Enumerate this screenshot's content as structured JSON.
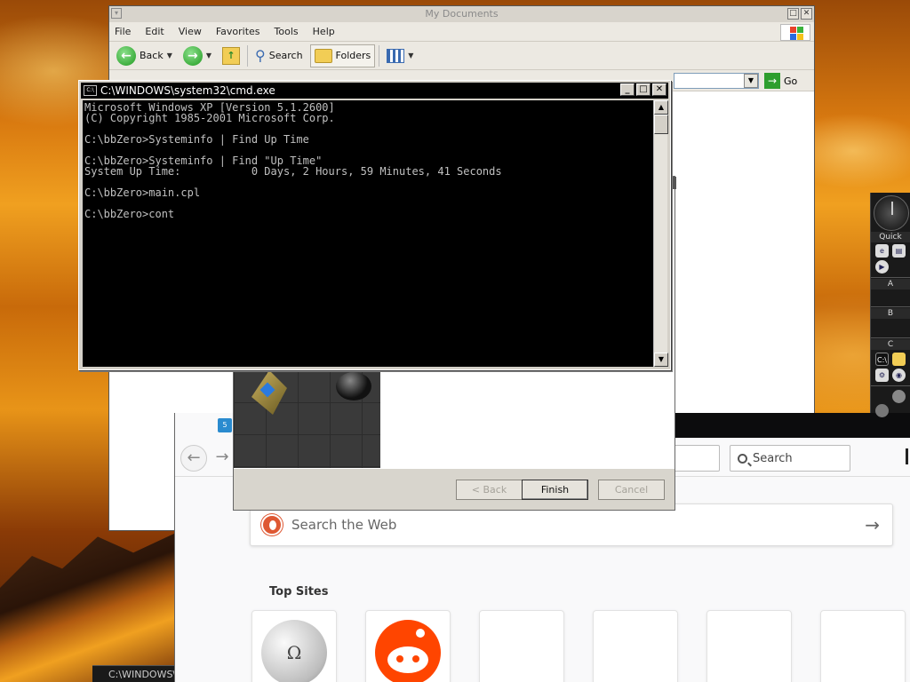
{
  "explorer": {
    "title": "My Documents",
    "menu": [
      "File",
      "Edit",
      "View",
      "Favorites",
      "Tools",
      "Help"
    ],
    "toolbar": {
      "back": "Back",
      "search": "Search",
      "folders": "Folders"
    },
    "address_go": "Go"
  },
  "cmd": {
    "title": "C:\\WINDOWS\\system32\\cmd.exe",
    "lines": [
      "Microsoft Windows XP [Version 5.1.2600]",
      "(C) Copyright 1985-2001 Microsoft Corp.",
      "",
      "C:\\bbZero>Systeminfo | Find Up Time",
      "",
      "C:\\bbZero>Systeminfo | Find \"Up Time\"",
      "System Up Time:           0 Days, 2 Hours, 59 Minutes, 41 Seconds",
      "",
      "C:\\bbZero>main.cpl",
      "",
      "C:\\bbZero>cont"
    ]
  },
  "wizard": {
    "back_label": "< Back",
    "finish_label": "Finish",
    "cancel_label": "Cancel"
  },
  "firefox": {
    "search_placeholder": "Search",
    "ddg_placeholder": "Search the Web",
    "top_sites_label": "Top Sites"
  },
  "slit": {
    "labels": [
      "Quick",
      "A",
      "B",
      "C"
    ]
  },
  "taskbar": {
    "cmd_button": "C:\\WINDOWS\\"
  }
}
